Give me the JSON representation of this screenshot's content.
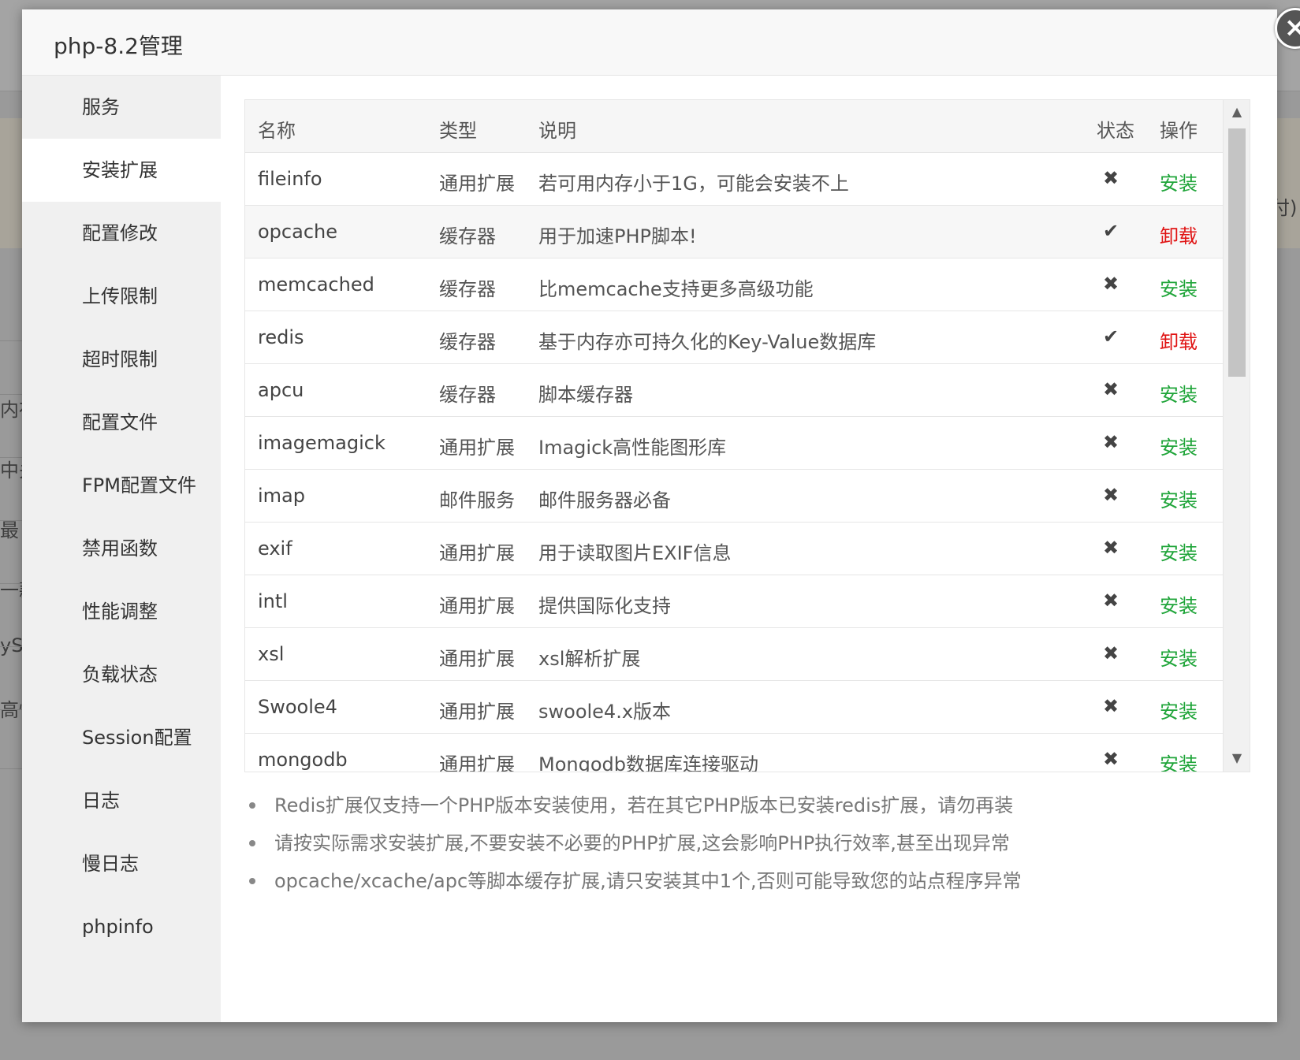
{
  "dialog": {
    "title": "php-8.2管理",
    "close_icon": "close-icon"
  },
  "background_fragments": [
    "付)",
    "内存",
    "中关",
    "最",
    "一款",
    "yS",
    "高性"
  ],
  "sidebar": {
    "items": [
      {
        "label": "服务",
        "active": false
      },
      {
        "label": "安装扩展",
        "active": true
      },
      {
        "label": "配置修改",
        "active": false
      },
      {
        "label": "上传限制",
        "active": false
      },
      {
        "label": "超时限制",
        "active": false
      },
      {
        "label": "配置文件",
        "active": false
      },
      {
        "label": "FPM配置文件",
        "active": false
      },
      {
        "label": "禁用函数",
        "active": false
      },
      {
        "label": "性能调整",
        "active": false
      },
      {
        "label": "负载状态",
        "active": false
      },
      {
        "label": "Session配置",
        "active": false
      },
      {
        "label": "日志",
        "active": false
      },
      {
        "label": "慢日志",
        "active": false
      },
      {
        "label": "phpinfo",
        "active": false
      }
    ]
  },
  "table": {
    "headers": {
      "name": "名称",
      "type": "类型",
      "desc": "说明",
      "status": "状态",
      "action": "操作"
    },
    "rows": [
      {
        "name": "fileinfo",
        "type": "通用扩展",
        "desc": "若可用内存小于1G，可能会安装不上",
        "status": "✖",
        "installed": false,
        "action": "安装"
      },
      {
        "name": "opcache",
        "type": "缓存器",
        "desc": "用于加速PHP脚本!",
        "status": "✔",
        "installed": true,
        "action": "卸载"
      },
      {
        "name": "memcached",
        "type": "缓存器",
        "desc": "比memcache支持更多高级功能",
        "status": "✖",
        "installed": false,
        "action": "安装"
      },
      {
        "name": "redis",
        "type": "缓存器",
        "desc": "基于内存亦可持久化的Key-Value数据库",
        "status": "✔",
        "installed": true,
        "action": "卸载"
      },
      {
        "name": "apcu",
        "type": "缓存器",
        "desc": "脚本缓存器",
        "status": "✖",
        "installed": false,
        "action": "安装"
      },
      {
        "name": "imagemagick",
        "type": "通用扩展",
        "desc": "Imagick高性能图形库",
        "status": "✖",
        "installed": false,
        "action": "安装"
      },
      {
        "name": "imap",
        "type": "邮件服务",
        "desc": "邮件服务器必备",
        "status": "✖",
        "installed": false,
        "action": "安装"
      },
      {
        "name": "exif",
        "type": "通用扩展",
        "desc": "用于读取图片EXIF信息",
        "status": "✖",
        "installed": false,
        "action": "安装"
      },
      {
        "name": "intl",
        "type": "通用扩展",
        "desc": "提供国际化支持",
        "status": "✖",
        "installed": false,
        "action": "安装"
      },
      {
        "name": "xsl",
        "type": "通用扩展",
        "desc": "xsl解析扩展",
        "status": "✖",
        "installed": false,
        "action": "安装"
      },
      {
        "name": "Swoole4",
        "type": "通用扩展",
        "desc": "swoole4.x版本",
        "status": "✖",
        "installed": false,
        "action": "安装"
      },
      {
        "name": "mongodb",
        "type": "通用扩展",
        "desc": "Mongodb数据库连接驱动",
        "status": "✖",
        "installed": false,
        "action": "安装"
      }
    ]
  },
  "notes": [
    "Redis扩展仅支持一个PHP版本安装使用，若在其它PHP版本已安装redis扩展，请勿再装",
    "请按实际需求安装扩展,不要安装不必要的PHP扩展,这会影响PHP执行效率,甚至出现异常",
    "opcache/xcache/apc等脚本缓存扩展,请只安装其中1个,否则可能导致您的站点程序异常"
  ],
  "colors": {
    "install": "#20a53a",
    "uninstall": "#e01414"
  }
}
